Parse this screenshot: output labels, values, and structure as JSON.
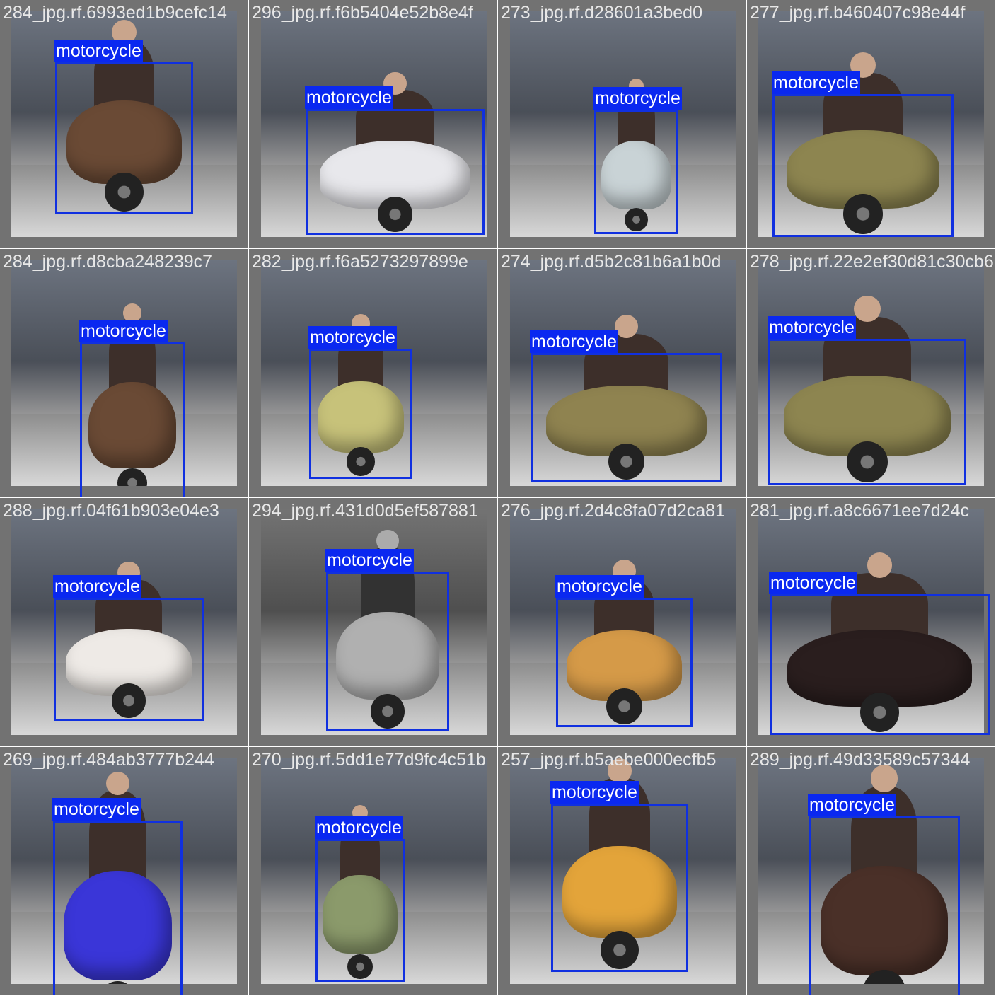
{
  "label_color": "#0a28f0",
  "tiles": [
    {
      "filename": "284_jpg.rf.6993ed1b9cefc14",
      "label": "motorcycle",
      "scooter_color": "#6a4a35"
    },
    {
      "filename": "296_jpg.rf.f6b5404e52b8e4f",
      "label": "motorcycle",
      "scooter_color": "#e8e8ec"
    },
    {
      "filename": "273_jpg.rf.d28601a3bed0",
      "label": "motorcycle",
      "scooter_color": "#c9d3d6"
    },
    {
      "filename": "277_jpg.rf.b460407c98e44f",
      "label": "motorcycle",
      "scooter_color": "#8d8550"
    },
    {
      "filename": "284_jpg.rf.d8cba248239c7",
      "label": "motorcycle",
      "scooter_color": "#6a4a35"
    },
    {
      "filename": "282_jpg.rf.f6a5273297899e",
      "label": "motorcycle",
      "scooter_color": "#c7c27a"
    },
    {
      "filename": "274_jpg.rf.d5b2c81b6a1b0d",
      "label": "motorcycle",
      "scooter_color": "#8f8350"
    },
    {
      "filename": "278_jpg.rf.22e2ef30d81c30cb6",
      "label": "motorcycle",
      "scooter_color": "#8d8550"
    },
    {
      "filename": "288_jpg.rf.04f61b903e04e3",
      "label": "motorcycle",
      "scooter_color": "#eeeae6"
    },
    {
      "filename": "294_jpg.rf.431d0d5ef587881",
      "label": "motorcycle",
      "scooter_color": "#b0b0b0"
    },
    {
      "filename": "276_jpg.rf.2d4c8fa07d2ca81",
      "label": "motorcycle",
      "scooter_color": "#d59a48"
    },
    {
      "filename": "281_jpg.rf.a8c6671ee7d24c",
      "label": "motorcycle",
      "scooter_color": "#2a1e1e"
    },
    {
      "filename": "269_jpg.rf.484ab3777b244",
      "label": "motorcycle",
      "scooter_color": "#3a36d8"
    },
    {
      "filename": "270_jpg.rf.5dd1e77d9fc4c51b",
      "label": "motorcycle",
      "scooter_color": "#8b9a6b"
    },
    {
      "filename": "257_jpg.rf.b5aebe000ecfb5",
      "label": "motorcycle",
      "scooter_color": "#e3a43a"
    },
    {
      "filename": "289_jpg.rf.49d33589c57344",
      "label": "motorcycle",
      "scooter_color": "#4a3028"
    }
  ]
}
